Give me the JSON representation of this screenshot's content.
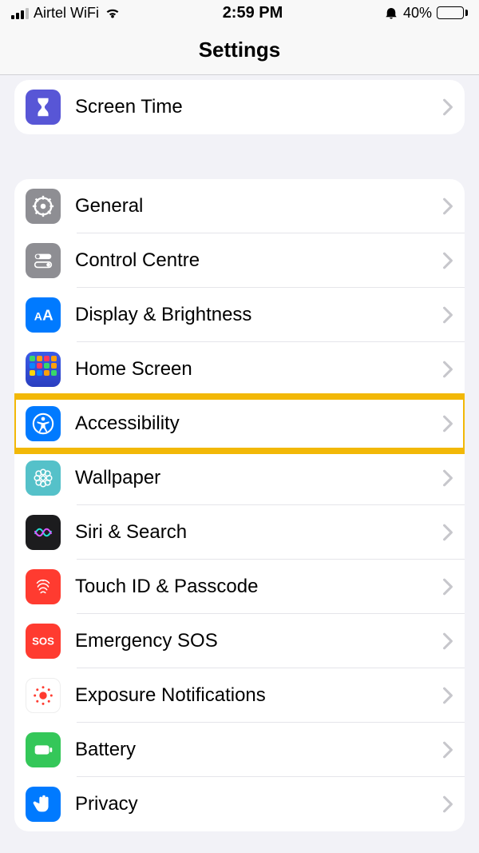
{
  "status": {
    "carrier": "Airtel WiFi",
    "time": "2:59 PM",
    "battery_pct": "40%",
    "battery_fill": 40
  },
  "header": {
    "title": "Settings"
  },
  "group1": [
    {
      "label": "Screen Time",
      "icon": "hourglass-icon",
      "bg": "bg-purple"
    }
  ],
  "group2": [
    {
      "label": "General",
      "icon": "gear-icon",
      "bg": "bg-gray"
    },
    {
      "label": "Control Centre",
      "icon": "switches-icon",
      "bg": "bg-gray"
    },
    {
      "label": "Display & Brightness",
      "icon": "text-aa-icon",
      "bg": "bg-blue"
    },
    {
      "label": "Home Screen",
      "icon": "home-grid-icon",
      "bg": "homegrid"
    },
    {
      "label": "Accessibility",
      "icon": "accessibility-icon",
      "bg": "bg-blue",
      "highlight": true
    },
    {
      "label": "Wallpaper",
      "icon": "flower-icon",
      "bg": "bg-cyan"
    },
    {
      "label": "Siri & Search",
      "icon": "siri-icon",
      "bg": "bg-black"
    },
    {
      "label": "Touch ID & Passcode",
      "icon": "fingerprint-icon",
      "bg": "bg-red"
    },
    {
      "label": "Emergency SOS",
      "icon": "sos-icon",
      "bg": "bg-redsos"
    },
    {
      "label": "Exposure Notifications",
      "icon": "exposure-icon",
      "bg": "bg-white"
    },
    {
      "label": "Battery",
      "icon": "battery-icon",
      "bg": "bg-green"
    },
    {
      "label": "Privacy",
      "icon": "hand-icon",
      "bg": "bg-blue"
    }
  ],
  "highlight_color": "#f2b807"
}
